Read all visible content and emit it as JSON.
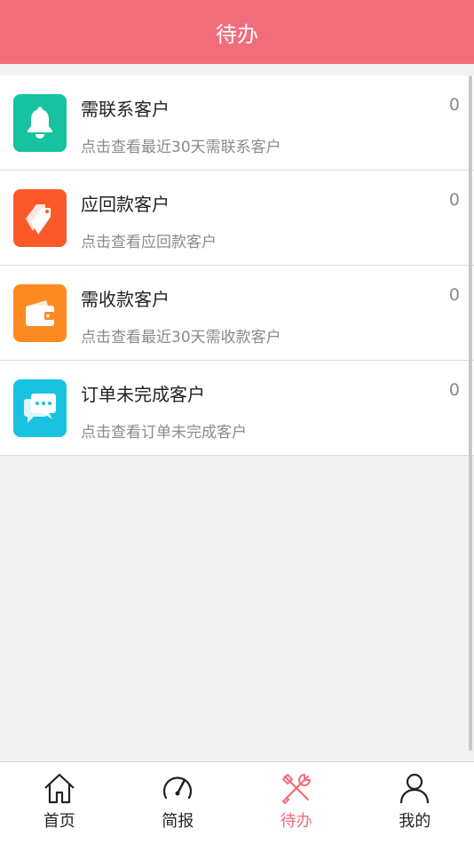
{
  "header": {
    "title": "待办"
  },
  "todo_items": [
    {
      "title": "需联系客户",
      "desc": "点击查看最近30天需联系客户",
      "count": "0",
      "icon": "bell-icon",
      "color": "#16c29f"
    },
    {
      "title": "应回款客户",
      "desc": "点击查看应回款客户",
      "count": "0",
      "icon": "tags-icon",
      "color": "#fb5a28"
    },
    {
      "title": "需收款客户",
      "desc": "点击查看最近30天需收款客户",
      "count": "0",
      "icon": "wallet-icon",
      "color": "#fc8a21"
    },
    {
      "title": "订单未完成客户",
      "desc": "点击查看订单未完成客户",
      "count": "0",
      "icon": "chat-icon",
      "color": "#19c3e0"
    }
  ],
  "tabbar": {
    "items": [
      {
        "label": "首页",
        "icon": "home-icon"
      },
      {
        "label": "简报",
        "icon": "speedometer-icon"
      },
      {
        "label": "待办",
        "icon": "tools-icon",
        "active": true
      },
      {
        "label": "我的",
        "icon": "user-icon"
      }
    ]
  },
  "colors": {
    "accent": "#f26d7b"
  }
}
